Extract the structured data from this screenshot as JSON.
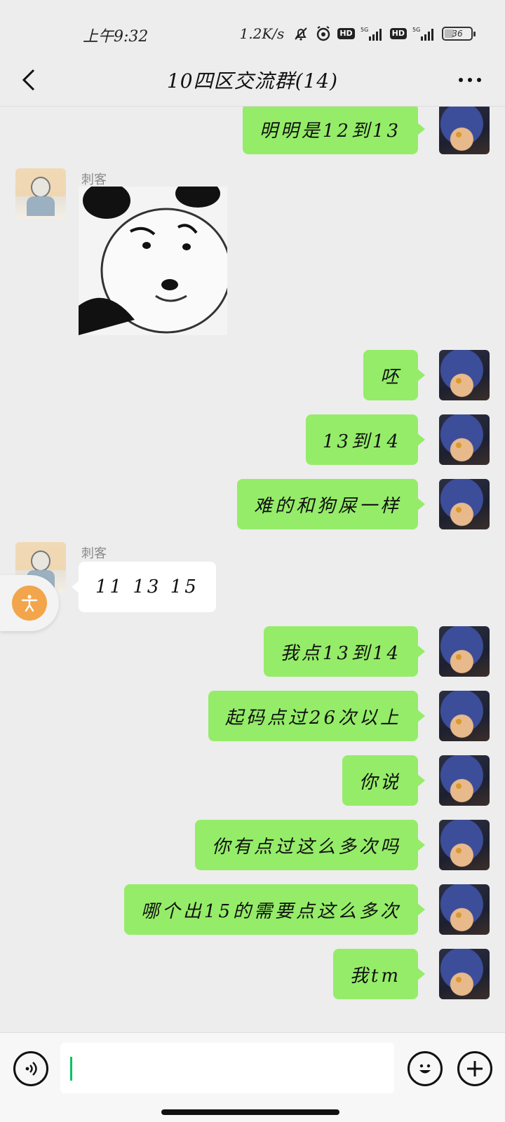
{
  "status_bar": {
    "time": "上午9:32",
    "net_speed": "1.2K/s",
    "hd1": "HD",
    "hd2": "HD",
    "sig1": "5G",
    "sig2": "5G",
    "battery": "36",
    "battery_level": 0.36
  },
  "header": {
    "title": "10四区交流群(14)"
  },
  "messages": [
    {
      "type": "text",
      "side": "out",
      "text": "明明是12到13"
    },
    {
      "type": "sticker",
      "side": "in",
      "sender": "刺客"
    },
    {
      "type": "text",
      "side": "out",
      "text": "呸"
    },
    {
      "type": "text",
      "side": "out",
      "text": "13到14"
    },
    {
      "type": "text",
      "side": "out",
      "text": "难的和狗屎一样"
    },
    {
      "type": "text",
      "side": "in",
      "sender": "刺客",
      "text": "11 13 15"
    },
    {
      "type": "text",
      "side": "out",
      "text": "我点13到14"
    },
    {
      "type": "text",
      "side": "out",
      "text": "起码点过26次以上"
    },
    {
      "type": "text",
      "side": "out",
      "text": "你说"
    },
    {
      "type": "text",
      "side": "out",
      "text": "你有点过这么多次吗"
    },
    {
      "type": "text",
      "side": "out",
      "text": "哪个出15的需要点这么多次"
    },
    {
      "type": "text",
      "side": "out",
      "text": "我tm"
    }
  ],
  "input_bar": {
    "value": ""
  },
  "colors": {
    "outgoing_bubble": "#95ec69",
    "incoming_bubble": "#ffffff",
    "background": "#ededed",
    "caret": "#07c160",
    "float_button": "#f2a54a"
  },
  "icons": {
    "back": "chevron-left-icon",
    "more": "more-dots-icon",
    "voice": "voice-icon",
    "emoji": "emoji-icon",
    "plus": "plus-icon",
    "accessibility": "accessibility-icon",
    "bell_off": "bell-off-icon",
    "alarm": "alarm-icon"
  }
}
